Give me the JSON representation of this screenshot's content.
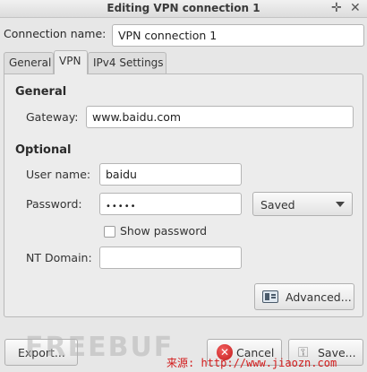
{
  "window": {
    "title": "Editing VPN connection 1",
    "pin_icon": "pin-icon",
    "close_icon": "close-icon"
  },
  "connection": {
    "label": "Connection name:",
    "value": "VPN connection 1"
  },
  "tabs": [
    {
      "label": "General",
      "active": false
    },
    {
      "label": "VPN",
      "active": true
    },
    {
      "label": "IPv4 Settings",
      "active": false
    }
  ],
  "general": {
    "title": "General",
    "gateway_label": "Gateway:",
    "gateway_value": "www.baidu.com"
  },
  "optional": {
    "title": "Optional",
    "username_label": "User name:",
    "username_value": "baidu",
    "password_label": "Password:",
    "password_mask": "•••••",
    "password_mode": "Saved",
    "show_password_label": "Show password",
    "show_password_checked": false,
    "nt_domain_label": "NT Domain:",
    "nt_domain_value": ""
  },
  "buttons": {
    "advanced": "Advanced...",
    "export": "Export...",
    "cancel": "Cancel",
    "save": "Save..."
  },
  "watermark": {
    "logo": "FREEBUF",
    "source": "来源: http://www.jiaozn.com"
  },
  "colors": {
    "accent_red": "#d21a1a",
    "window_bg": "#e7e7e7"
  }
}
